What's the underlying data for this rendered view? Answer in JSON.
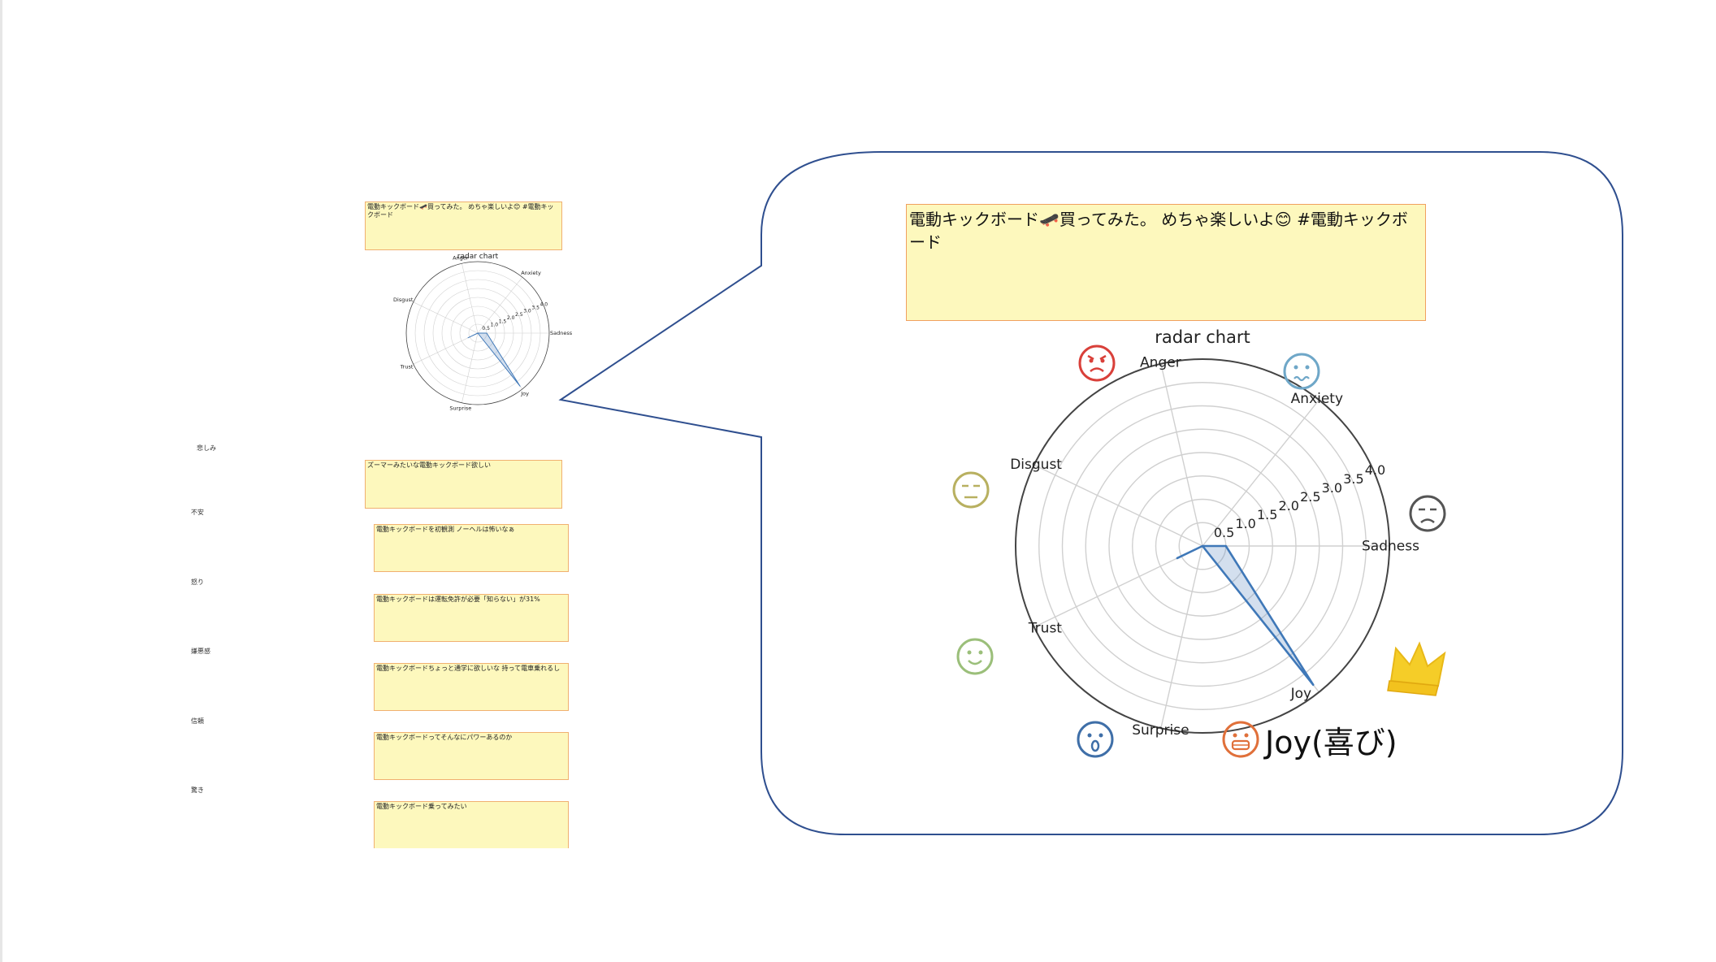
{
  "top_post": {
    "text": "電動キックボード🛹買ってみた。 めちゃ楽しいよ😊 #電動キックボード"
  },
  "posts": [
    {
      "label": "悲しみ",
      "text": "ズーマーみたいな電動キックボード欲しい"
    },
    {
      "label": "不安",
      "text": "電動キックボードを初観測 ノーヘルは怖いなぁ"
    },
    {
      "label": "怒り",
      "text": "電動キックボードは運転免許が必要「知らない」が31%"
    },
    {
      "label": "嫌悪感",
      "text": "電動キックボードちょっと通学に欲しいな 持って電車乗れるし"
    },
    {
      "label": "信頼",
      "text": "電動キックボードってそんなにパワーあるのか"
    },
    {
      "label": "驚き",
      "text": "電動キックボード乗ってみたい"
    }
  ],
  "callout": {
    "post_text": "電動キックボード🛹買ってみた。 めちゃ楽しいよ😊 #電動キックボード",
    "top_emotion": "Joy(喜び)"
  },
  "colors": {
    "anger": "#d9403a",
    "anxiety": "#6fa7c8",
    "sadness": "#555555",
    "joy": "#e0703a",
    "surprise": "#3f6fa8",
    "trust": "#9bbf7a",
    "disgust": "#b8b060",
    "crown": "#f5cd28",
    "callout_stroke": "#2f4f8f"
  },
  "chart_data": {
    "type": "radar",
    "title": "radar chart",
    "axes": [
      "Sadness",
      "Anxiety",
      "Anger",
      "Disgust",
      "Trust",
      "Surprise",
      "Joy"
    ],
    "values": [
      0.5,
      0.0,
      0.0,
      0.0,
      0.6,
      0.0,
      3.8
    ],
    "rticks": [
      "0.5",
      "1.0",
      "1.5",
      "2.0",
      "2.5",
      "3.0",
      "3.5",
      "4.0"
    ],
    "rlim": [
      0,
      4.0
    ],
    "icons": [
      "sad-face-icon",
      "anxious-face-icon",
      "angry-face-icon",
      "unamused-face-icon",
      "smiling-face-icon",
      "surprised-face-icon",
      "grinning-face-icon"
    ]
  }
}
